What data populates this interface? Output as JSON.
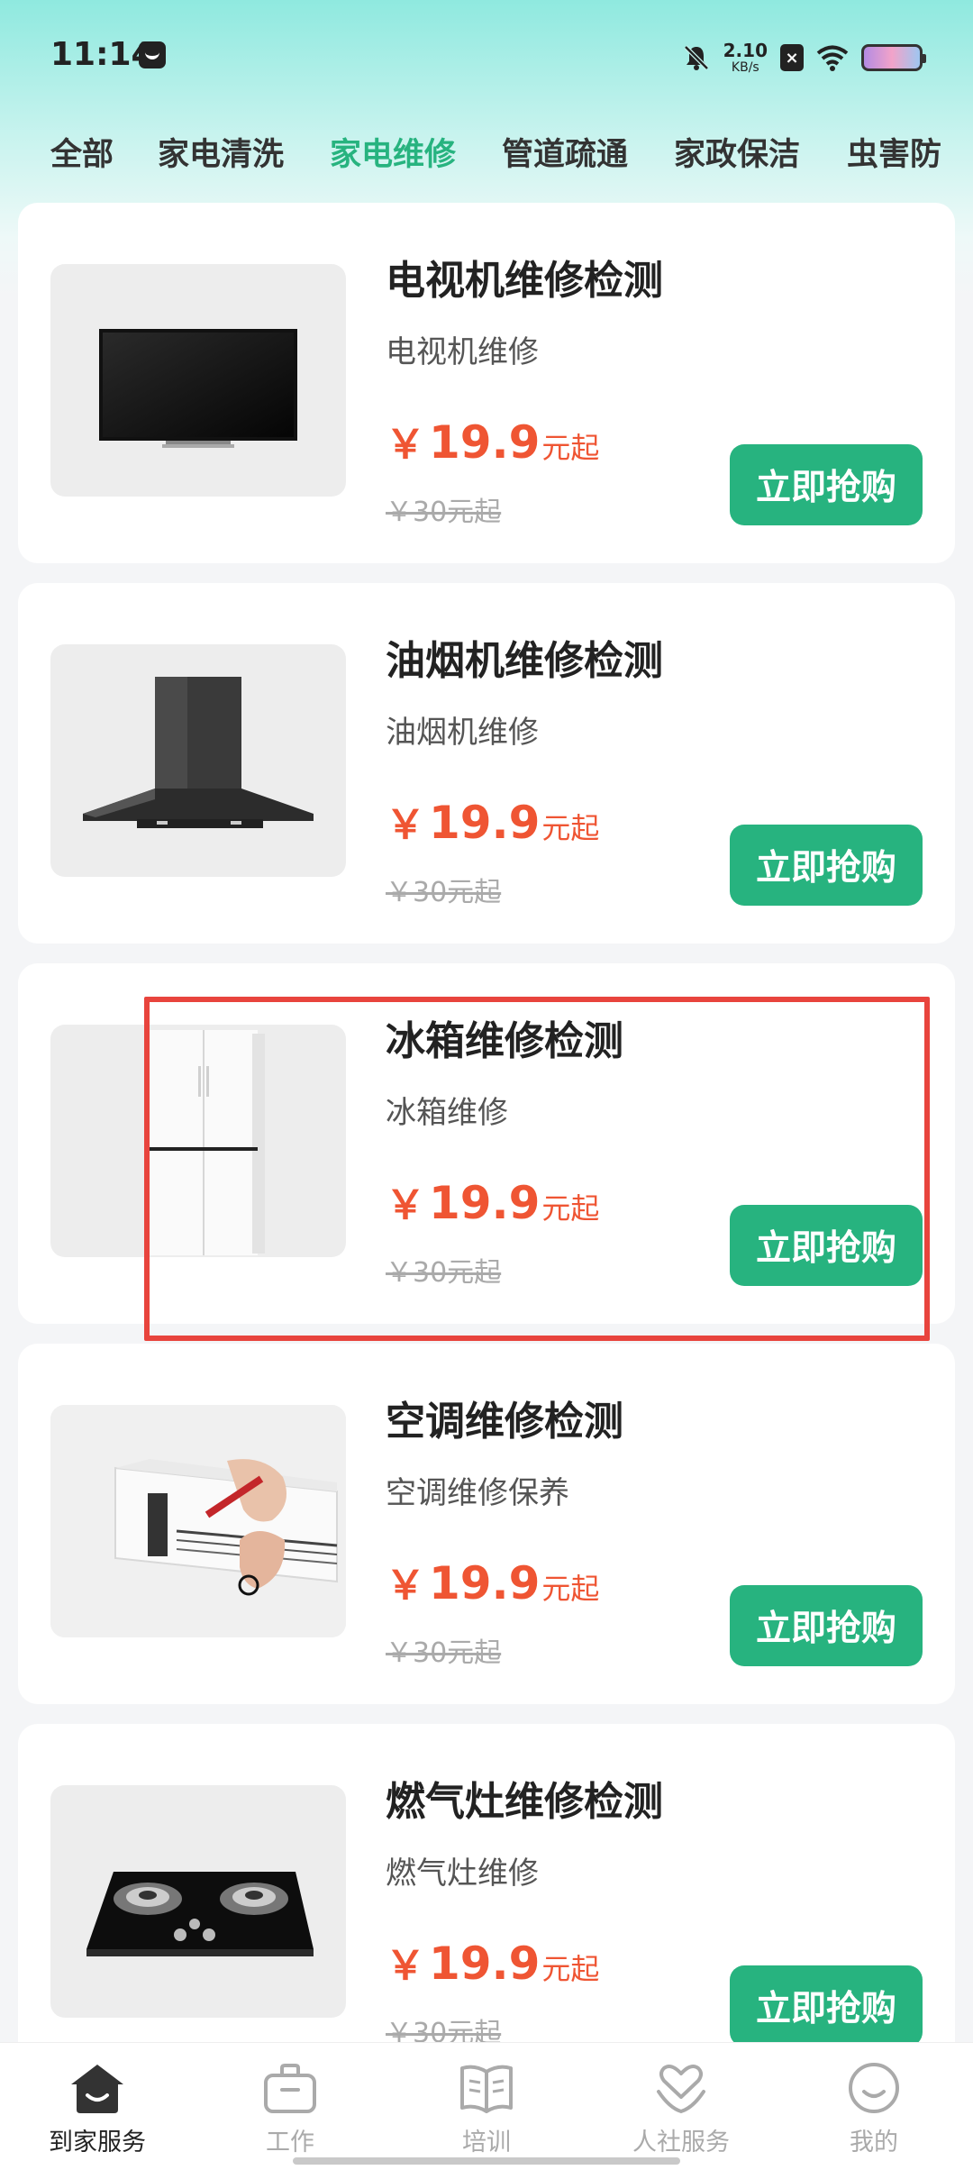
{
  "status_bar": {
    "time": "11:14",
    "net_speed_value": "2.10",
    "net_speed_unit": "KB/s",
    "icons": [
      "app-notification-icon",
      "bell-muted-icon",
      "sim-off-icon",
      "wifi-icon",
      "battery-icon"
    ]
  },
  "tabs": [
    {
      "label": "全部"
    },
    {
      "label": "家电清洗"
    },
    {
      "label": "家电维修",
      "active": true
    },
    {
      "label": "管道疏通"
    },
    {
      "label": "家政保洁"
    },
    {
      "label": "虫害防"
    }
  ],
  "services": [
    {
      "title": "电视机维修检测",
      "subtitle": "电视机维修",
      "price_symbol": "￥",
      "price": "19.9",
      "price_suffix": "元起",
      "original_price": "￥30元起",
      "button": "立即抢购",
      "image": "tv-image"
    },
    {
      "title": "油烟机维修检测",
      "subtitle": "油烟机维修",
      "price_symbol": "￥",
      "price": "19.9",
      "price_suffix": "元起",
      "original_price": "￥30元起",
      "button": "立即抢购",
      "image": "range-hood-image"
    },
    {
      "title": "冰箱维修检测",
      "subtitle": "冰箱维修",
      "price_symbol": "￥",
      "price": "19.9",
      "price_suffix": "元起",
      "original_price": "￥30元起",
      "button": "立即抢购",
      "image": "fridge-image"
    },
    {
      "title": "空调维修检测",
      "subtitle": "空调维修保养",
      "price_symbol": "￥",
      "price": "19.9",
      "price_suffix": "元起",
      "original_price": "￥30元起",
      "button": "立即抢购",
      "image": "air-conditioner-image"
    },
    {
      "title": "燃气灶维修检测",
      "subtitle": "燃气灶维修",
      "price_symbol": "￥",
      "price": "19.9",
      "price_suffix": "元起",
      "original_price": "￥30元起",
      "button": "立即抢购",
      "image": "gas-stove-image"
    }
  ],
  "bottom_nav": [
    {
      "label": "到家服务",
      "icon": "home-icon",
      "active": true
    },
    {
      "label": "工作",
      "icon": "briefcase-icon"
    },
    {
      "label": "培训",
      "icon": "book-icon"
    },
    {
      "label": "人社服务",
      "icon": "heart-hand-icon"
    },
    {
      "label": "我的",
      "icon": "smile-icon"
    }
  ],
  "colors": {
    "accent": "#27b37f",
    "price": "#ef5533",
    "highlight": "#e8443d"
  }
}
